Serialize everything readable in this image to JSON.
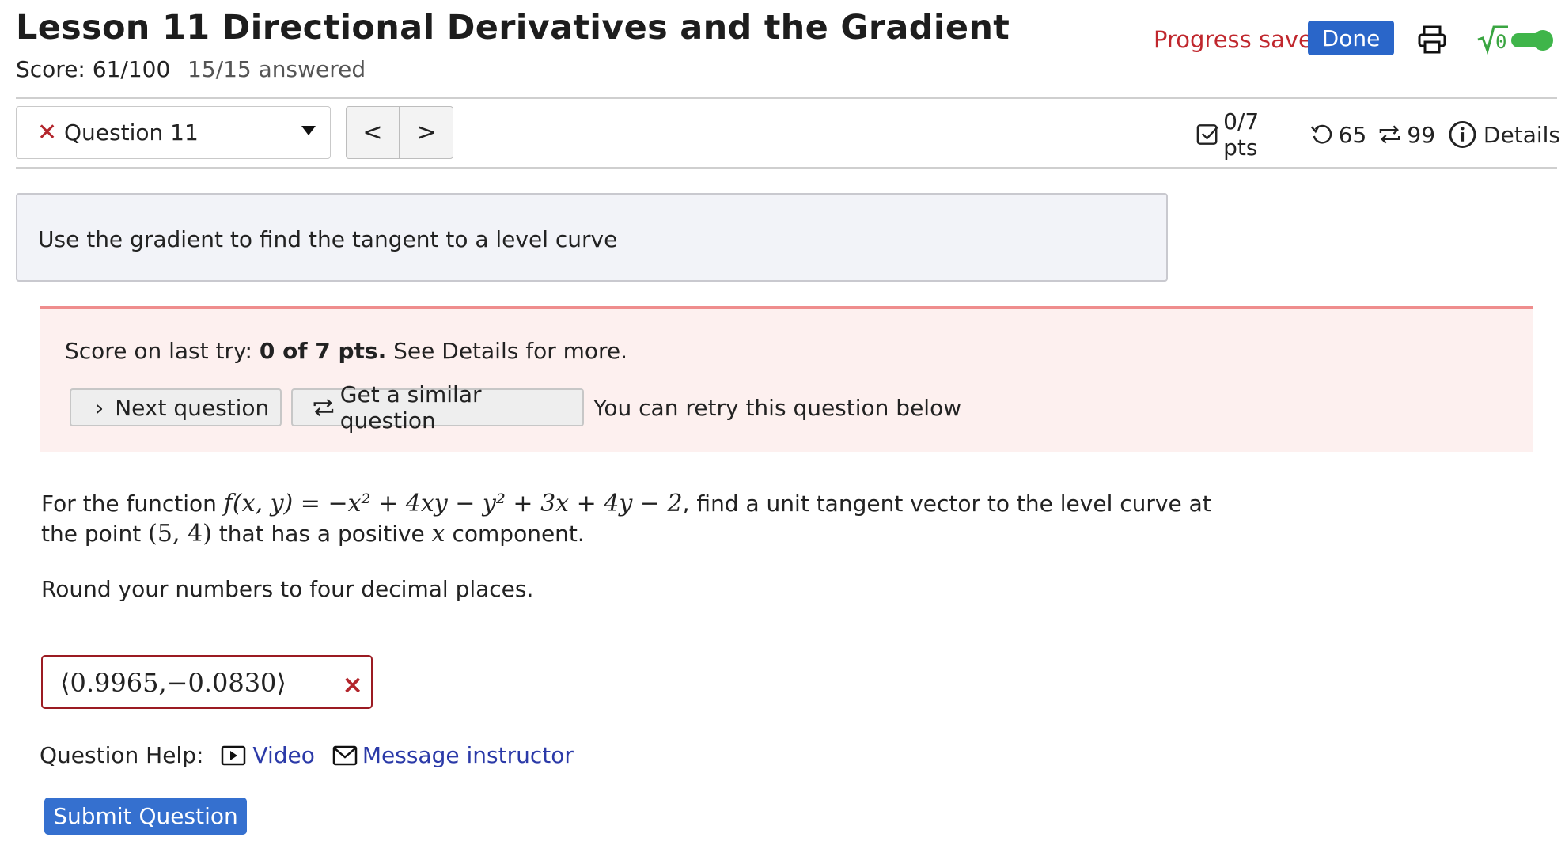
{
  "header": {
    "title": "Lesson 11 Directional Derivatives and the Gradient",
    "score": "Score: 61/100",
    "answered": "15/15 answered",
    "progress_saved": "Progress saved",
    "done_label": "Done",
    "print_icon": "print-icon",
    "sqrt_toggle_icon": "sqrt-toggle-icon"
  },
  "question_nav": {
    "selected_question": "Question 11",
    "status_icon": "x-icon",
    "prev_label": "<",
    "next_label": ">"
  },
  "stats": {
    "points": "0/7 pts",
    "attempts_icon": "undo-icon",
    "attempts": "65",
    "versions_icon": "repeat-icon",
    "versions": "99",
    "details_label": "Details"
  },
  "question_description": "Use the gradient to find the tangent to a level curve",
  "feedback": {
    "prefix": "Score on last try: ",
    "score": "0 of 7 pts.",
    "suffix": " See Details for more.",
    "next_question": "Next question",
    "similar_question": "Get a similar question",
    "retry_text": "You can retry this question below"
  },
  "problem": {
    "line1_start": "For the function ",
    "function": "f(x, y) = −x² + 4xy − y² + 3x + 4y − 2",
    "line1_end": ", find a unit tangent vector to the level curve at",
    "line2_start": "the point ",
    "point": "(5, 4)",
    "line2_mid": " that has a positive ",
    "x_var": "x",
    "line2_end": " component.",
    "rounding": "Round your numbers to four decimal places."
  },
  "answer": {
    "value": "⟨0.9965,−0.0830⟩",
    "status": "×"
  },
  "help": {
    "label": "Question Help:",
    "video": "Video",
    "message": "Message instructor"
  },
  "submit_label": "Submit Question",
  "colors": {
    "accent_blue": "#2a66c9",
    "error_red": "#c0272d",
    "link_blue": "#2b3aa8",
    "feedback_bg": "#fdf0ef",
    "toggle_green": "#3fb54a"
  }
}
